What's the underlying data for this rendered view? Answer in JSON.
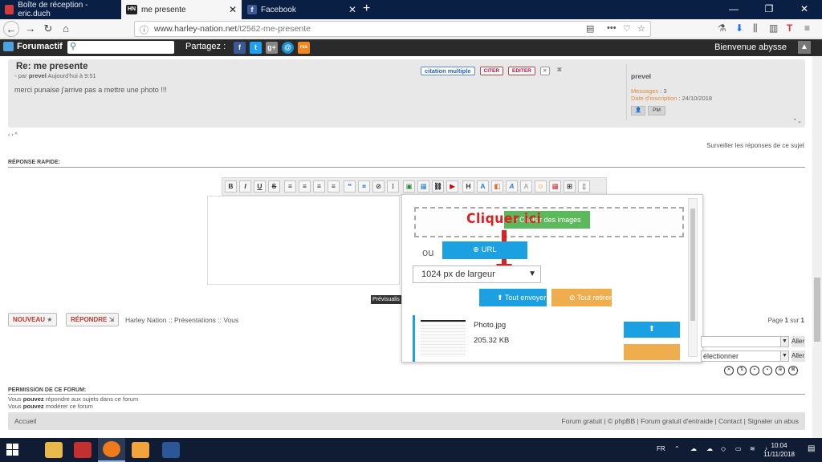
{
  "browser": {
    "tabs": [
      {
        "title": "Boîte de réception - eric.duch",
        "active": false
      },
      {
        "title": "me presente",
        "active": true,
        "favicon_text": "HN"
      },
      {
        "title": "Facebook",
        "active": false,
        "favicon_text": "f"
      }
    ],
    "url_host": "www.harley-nation.net",
    "url_path": "/t2562-me-presente",
    "url_more": "•••"
  },
  "forumactif_bar": {
    "logo_label": "Forumactif",
    "share_label": "Partagez :",
    "social": [
      "f",
      "t",
      "g+",
      "@",
      "rss"
    ],
    "welcome": "Bienvenue abysse"
  },
  "post": {
    "title": "Re: me presente",
    "meta_prefix": "par",
    "author": "prevel",
    "time": "Aujourd'hui à 9:51",
    "body": "merci punaise j'arrive pas a mettre une photo !!!",
    "actions": {
      "multi_quote": "citation multiple",
      "quote": "CITER",
      "edit": "EDITER"
    },
    "profile": {
      "name": "prevel",
      "messages_label": "Messages",
      "messages_value": "3",
      "signup_label": "Date d'inscription",
      "signup_value": "24/10/2018",
      "pm_label": "PM"
    }
  },
  "watch_topic": "Surveiller les réponses de ce sujet",
  "quick_reply_title": "RÉPONSE RAPIDE:",
  "editor": {
    "format": [
      "B",
      "I",
      "U",
      "S"
    ],
    "heading": "H",
    "preview": "Prévisualis"
  },
  "upload": {
    "annotation": "Cliquer ici",
    "choose_label": "Choisir des images",
    "or_label": "ou",
    "url_label": "URL",
    "width_option": "1024 px de largeur",
    "send_all": "Tout envoyer",
    "remove_all": "Tout retirer",
    "file": {
      "name": "Photo.jpg",
      "size": "205.32 KB"
    }
  },
  "buttons": {
    "new": "NOUVEAU",
    "reply": "RÉPONDRE"
  },
  "breadcrumb": "Harley Nation :: Présentations :: Vous",
  "pagination": {
    "prefix": "Page",
    "current": "1",
    "of": "sur",
    "total": "1"
  },
  "jump": {
    "select2": "électionner",
    "go": "Aller"
  },
  "permissions": {
    "title": "PERMISSION DE CE FORUM:",
    "line1_a": "Vous",
    "line1_b": "pouvez",
    "line1_c": "répondre aux sujets dans ce forum",
    "line2_a": "Vous",
    "line2_b": "pouvez",
    "line2_c": "modérer ce forum"
  },
  "footer": {
    "home": "Accueil",
    "links": "Forum gratuit | © phpBB | Forum gratuit d'entraide | Contact | Signaler un abus"
  },
  "taskbar": {
    "lang": "FR",
    "time": "10:04",
    "date": "11/11/2018"
  },
  "colors": {
    "accent_blue": "#1ba1e2",
    "green": "#5cb85c",
    "orange": "#f0ad4e",
    "annotation_red": "#e02020"
  }
}
